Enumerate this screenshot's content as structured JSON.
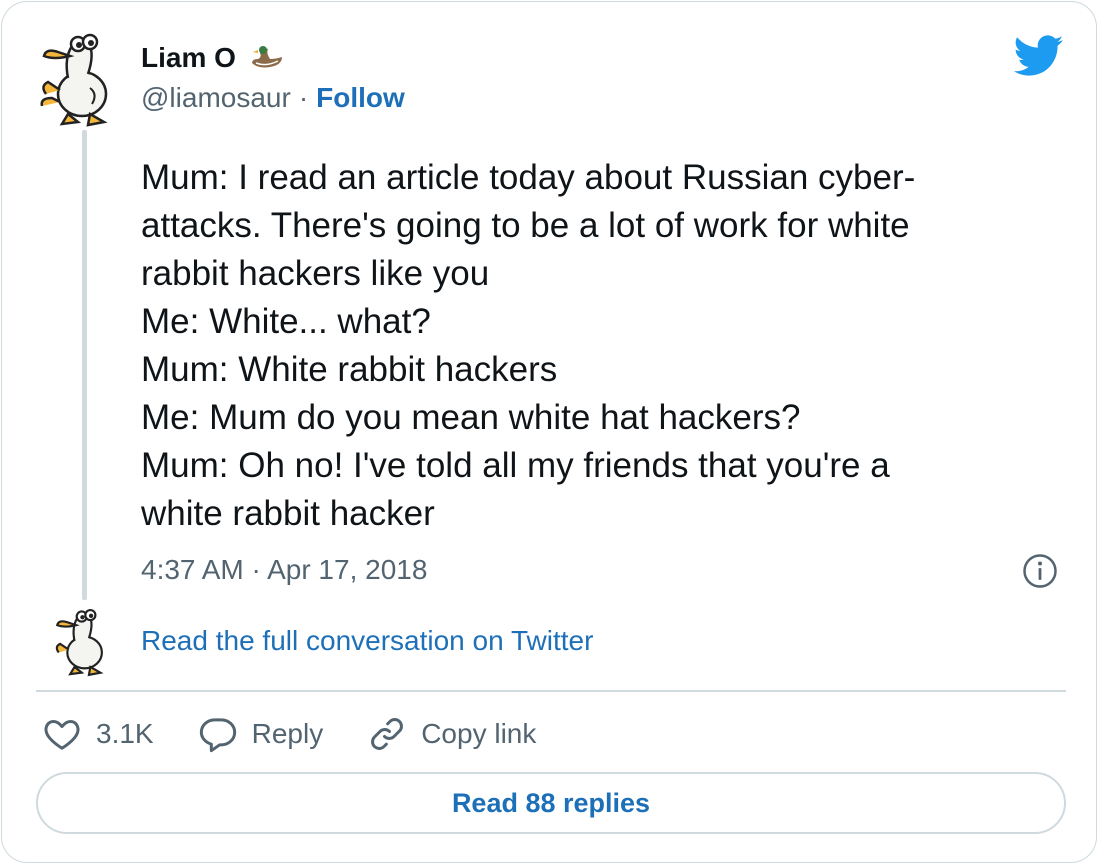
{
  "author": {
    "name": "Liam O",
    "handle": "@liamosaur",
    "separator": "·",
    "follow_label": "Follow"
  },
  "tweet": {
    "lines": [
      "Mum: I read an article today about Russian cyber-",
      "attacks. There's going to be a lot of work for white",
      "rabbit hackers like you",
      "Me: White... what?",
      "Mum: White rabbit hackers",
      "Me: Mum do you mean white hat hackers?",
      "Mum: Oh no! I've told all my friends that you're a",
      "white rabbit hacker"
    ],
    "timestamp": "4:37 AM · Apr 17, 2018"
  },
  "conversation_link": "Read the full conversation on Twitter",
  "actions": {
    "likes_count": "3.1K",
    "reply_label": "Reply",
    "copy_link_label": "Copy link"
  },
  "read_replies_label": "Read 88 replies",
  "colors": {
    "twitter_blue": "#1d9bf0",
    "link_blue": "#1d70b8",
    "secondary_text": "#536471",
    "border": "#cfd9de"
  },
  "icons": [
    "duck-avatar-icon",
    "duck-emoji-icon",
    "twitter-bird-icon",
    "info-icon",
    "heart-icon",
    "reply-bubble-icon",
    "link-icon"
  ]
}
